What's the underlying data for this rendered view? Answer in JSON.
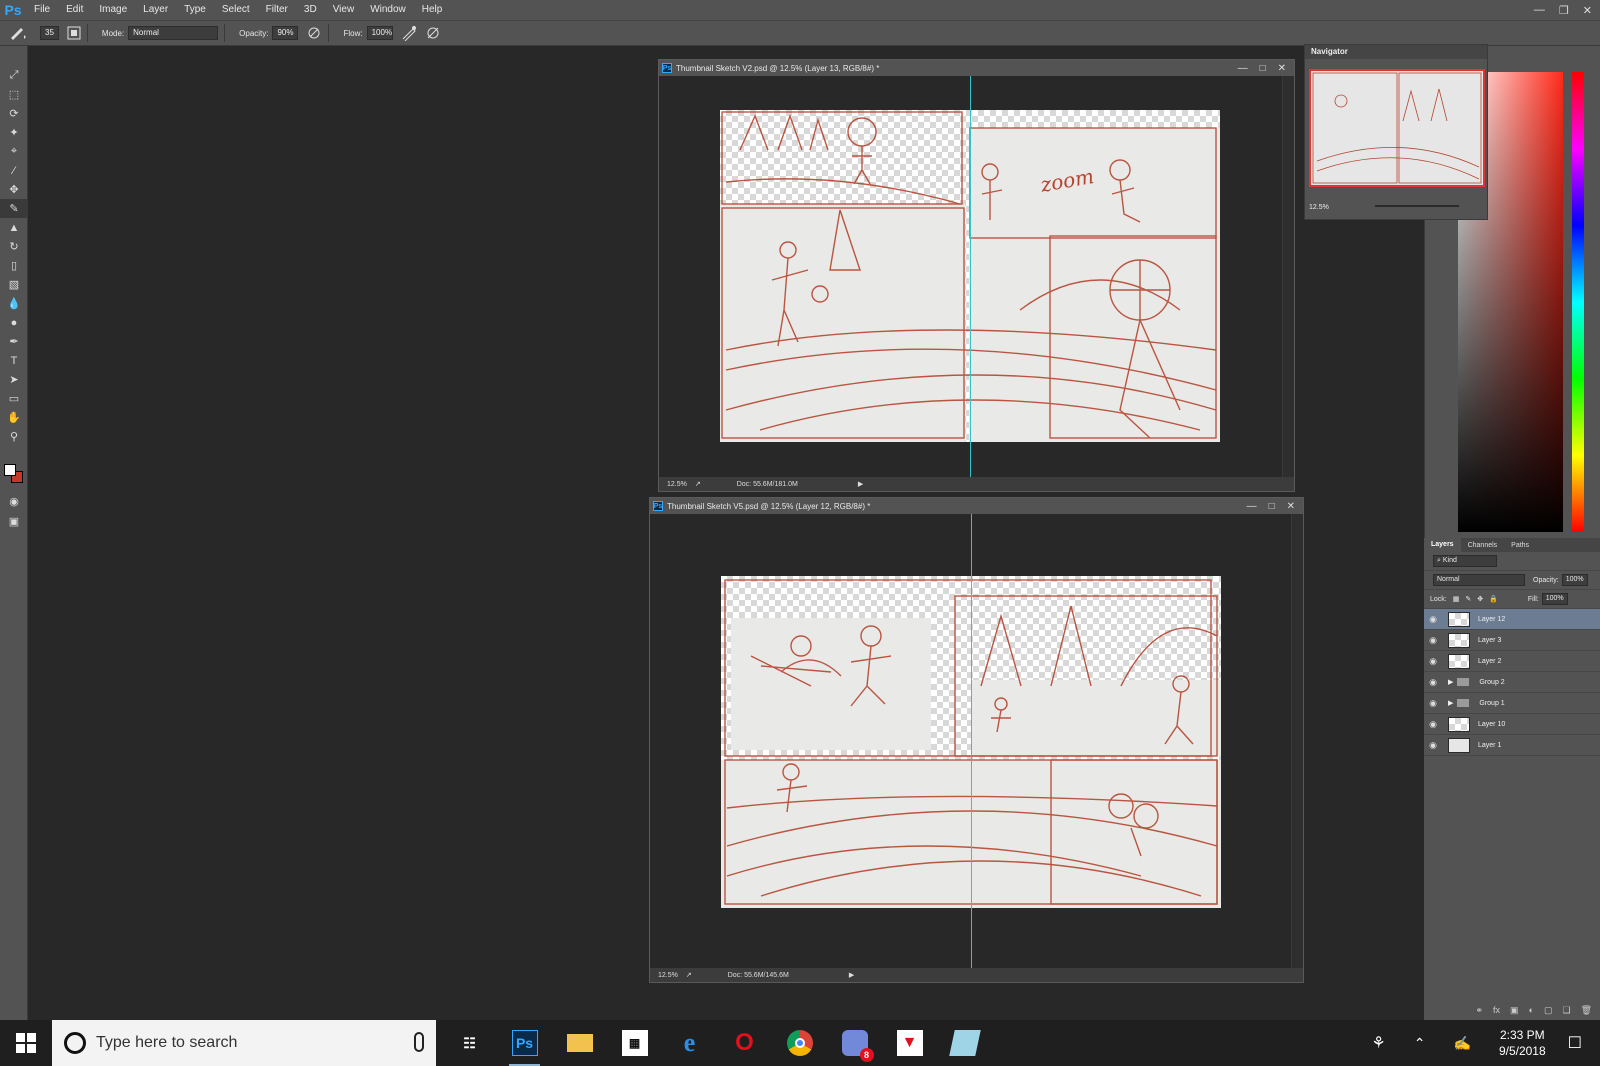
{
  "menubar": {
    "logo": "Ps",
    "items": [
      "File",
      "Edit",
      "Image",
      "Layer",
      "Type",
      "Select",
      "Filter",
      "3D",
      "View",
      "Window",
      "Help"
    ]
  },
  "options": {
    "brush_size": "35",
    "mode_label": "Mode:",
    "mode_value": "Normal",
    "opacity_label": "Opacity:",
    "opacity_value": "90%",
    "flow_label": "Flow:",
    "flow_value": "100%"
  },
  "tools": [
    "move-tool",
    "marquee-tool",
    "lasso-tool",
    "quick-select-tool",
    "crop-tool",
    "eyedropper-tool",
    "healing-tool",
    "brush-tool",
    "stamp-tool",
    "history-brush-tool",
    "eraser-tool",
    "gradient-tool",
    "blur-tool",
    "dodge-tool",
    "pen-tool",
    "type-tool",
    "path-select-tool",
    "shape-tool",
    "hand-tool",
    "zoom-tool"
  ],
  "doc1": {
    "title": "Thumbnail Sketch V2.psd @ 12.5% (Layer 13, RGB/8#) *",
    "zoom": "12.5%",
    "doc_info": "Doc: 55.6M/181.0M"
  },
  "doc2": {
    "title": "Thumbnail Sketch V5.psd @ 12.5% (Layer 12, RGB/8#) *",
    "zoom": "12.5%",
    "doc_info": "Doc: 55.6M/145.6M"
  },
  "navigator": {
    "tab": "Navigator",
    "zoom": "12.5%"
  },
  "layers_panel": {
    "tabs": [
      "Layers",
      "Channels",
      "Paths"
    ],
    "kind_label": "Kind",
    "blend_mode": "Normal",
    "opacity_label": "Opacity:",
    "opacity_value": "100%",
    "lock_label": "Lock:",
    "fill_label": "Fill:",
    "fill_value": "100%",
    "layers": [
      {
        "name": "Layer 12",
        "selected": true,
        "type": "layer"
      },
      {
        "name": "Layer 3",
        "selected": false,
        "type": "layer"
      },
      {
        "name": "Layer 2",
        "selected": false,
        "type": "layer"
      },
      {
        "name": "Group 2",
        "selected": false,
        "type": "group"
      },
      {
        "name": "Group 1",
        "selected": false,
        "type": "group"
      },
      {
        "name": "Layer 10",
        "selected": false,
        "type": "layer"
      },
      {
        "name": "Layer 1",
        "selected": false,
        "type": "layer"
      }
    ]
  },
  "canvas_text": {
    "zoom_word": "zoom"
  },
  "taskbar": {
    "search_placeholder": "Type here to search",
    "time": "2:33 PM",
    "date": "9/5/2018",
    "badge": "8",
    "apps": [
      "task-view-icon",
      "photoshop-icon",
      "file-explorer-icon",
      "store-icon",
      "edge-icon",
      "opera-icon",
      "chrome-icon",
      "discord-icon",
      "antivirus-icon",
      "notes-icon"
    ]
  },
  "colors": {
    "accent": "#31a8ff",
    "sketch": "#b5452e",
    "guide": "#35c3c8",
    "selected_layer": "#6b7c93"
  }
}
